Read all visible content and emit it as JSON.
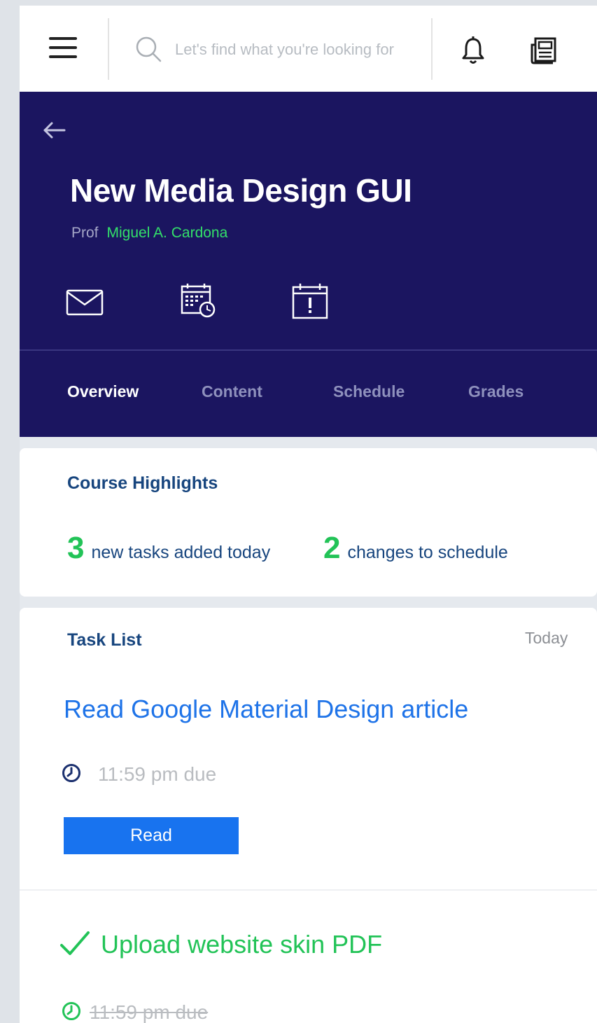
{
  "topbar": {
    "menu_icon": "hamburger-icon",
    "search_icon": "search-icon",
    "search_placeholder": "Let's find what you're looking for",
    "notifications_icon": "bell-icon",
    "news_icon": "newspaper-icon"
  },
  "header": {
    "back_icon": "arrow-left-icon",
    "title": "New Media Design GUI",
    "prof_label": "Prof",
    "prof_name": "Miguel A. Cardona",
    "action_icons": [
      "mail-icon",
      "calendar-clock-icon",
      "calendar-alert-icon"
    ],
    "tabs": [
      {
        "label": "Overview",
        "active": true
      },
      {
        "label": "Content",
        "active": false
      },
      {
        "label": "Schedule",
        "active": false
      },
      {
        "label": "Grades",
        "active": false
      }
    ],
    "colors": {
      "background": "#1b1560",
      "accent": "#33e06a",
      "inactive_tab": "#8f91bd"
    }
  },
  "highlights": {
    "title": "Course Highlights",
    "stats": [
      {
        "value": "3",
        "label": "new tasks added today"
      },
      {
        "value": "2",
        "label": "changes to schedule"
      }
    ]
  },
  "tasks": {
    "title": "Task List",
    "date_label": "Today",
    "items": [
      {
        "title": "Read Google Material Design article",
        "due": "11:59 pm due",
        "action": "Read",
        "completed": false
      },
      {
        "title": "Upload website skin PDF",
        "due": "11:59 pm due",
        "completed": true
      }
    ],
    "colors": {
      "link": "#1e73e8",
      "done": "#22c357",
      "button": "#1873ef"
    }
  }
}
